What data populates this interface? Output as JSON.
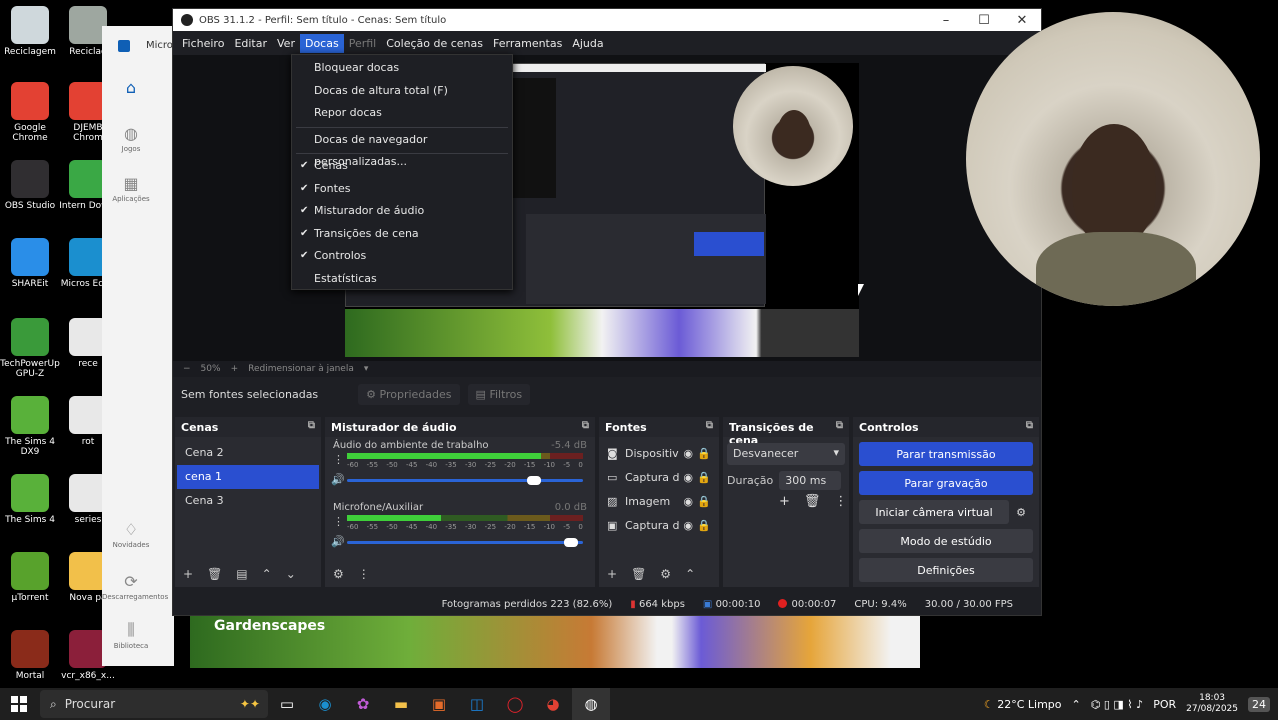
{
  "desktop_icons": [
    {
      "label": "Reciclagem",
      "icon": "recycle-bin-icon",
      "color": "#cfd8dc"
    },
    {
      "label": "Reciclag",
      "icon": "recycle-bin-icon",
      "color": "#9ea7a0"
    },
    {
      "label": "Google Chrome",
      "icon": "chrome-icon",
      "color": "#e34133"
    },
    {
      "label": "DJEMB Chrom",
      "icon": "chrome-icon",
      "color": "#e34133"
    },
    {
      "label": "OBS Studio",
      "icon": "obs-icon",
      "color": "#302e31"
    },
    {
      "label": "Intern Downl",
      "icon": "download-icon",
      "color": "#3aa845"
    },
    {
      "label": "SHAREit",
      "icon": "shareit-icon",
      "color": "#2a8ee8"
    },
    {
      "label": "Micros Edge",
      "icon": "edge-icon",
      "color": "#1b8fcf"
    },
    {
      "label": "TechPowerUp GPU-Z",
      "icon": "gpuz-icon",
      "color": "#3a9a3a"
    },
    {
      "label": "rece",
      "icon": "file-icon",
      "color": "#e8e8e8"
    },
    {
      "label": "The Sims 4 DX9",
      "icon": "sims-icon",
      "color": "#59b13a"
    },
    {
      "label": "rot",
      "icon": "file-icon",
      "color": "#e8e8e8"
    },
    {
      "label": "The Sims 4",
      "icon": "sims-icon",
      "color": "#59b13a"
    },
    {
      "label": "series",
      "icon": "file-icon",
      "color": "#e8e8e8"
    },
    {
      "label": "µTorrent",
      "icon": "utorrent-icon",
      "color": "#58a22c"
    },
    {
      "label": "Nova pa",
      "icon": "folder-icon",
      "color": "#f2c04a"
    },
    {
      "label": "Mortal",
      "icon": "game-icon",
      "color": "#8a2b1a"
    },
    {
      "label": "vcr_x86_x...",
      "icon": "winrar-icon",
      "color": "#8b1f3a"
    }
  ],
  "store_sidebar": {
    "title": "Micro",
    "items": [
      {
        "label": "",
        "icon": "home-icon"
      },
      {
        "label": "Jogos",
        "icon": "gamepad-icon"
      },
      {
        "label": "Aplicações",
        "icon": "apps-icon"
      },
      {
        "label": "Novidades",
        "icon": "bell-icon"
      },
      {
        "label": "Descarregamentos",
        "icon": "download-icon"
      },
      {
        "label": "Biblioteca",
        "icon": "library-icon"
      }
    ]
  },
  "game_banner": {
    "title": "Gardenscapes"
  },
  "obs": {
    "title": "OBS 31.1.2 - Perfil: Sem título - Cenas: Sem título",
    "menu": [
      "Ficheiro",
      "Editar",
      "Ver",
      "Docas",
      "Perfil",
      "Coleção de cenas",
      "Ferramentas",
      "Ajuda"
    ],
    "active_menu": "Docas",
    "zoom": "50%",
    "zoom_mode": "Redimensionar à janela",
    "no_sources": "Sem fontes selecionadas",
    "properties_btn": "Propriedades",
    "filters_btn": "Filtros",
    "docks": {
      "scenes": {
        "title": "Cenas",
        "items": [
          "Cena 2",
          "cena 1",
          "Cena 3"
        ],
        "selected": 1
      },
      "mixer": {
        "title": "Misturador de áudio",
        "channels": [
          {
            "name": "Áudio do ambiente de trabalho",
            "db": "-5.4 dB",
            "level": 0.82,
            "volume": 0.82
          },
          {
            "name": "Microfone/Auxiliar",
            "db": "0.0 dB",
            "level": 0.4,
            "volume": 0.98
          }
        ],
        "ticks": [
          "-60",
          "-55",
          "-50",
          "-45",
          "-40",
          "-35",
          "-30",
          "-25",
          "-20",
          "-15",
          "-10",
          "-5",
          "0"
        ]
      },
      "sources": {
        "title": "Fontes",
        "items": [
          {
            "name": "Dispositiv",
            "icon": "camera-icon"
          },
          {
            "name": "Captura d",
            "icon": "monitor-icon"
          },
          {
            "name": "Imagem",
            "icon": "image-icon"
          },
          {
            "name": "Captura d",
            "icon": "window-icon"
          }
        ]
      },
      "transitions": {
        "title": "Transições de cena",
        "type": "Desvanecer",
        "duration_label": "Duração",
        "duration": "300 ms"
      },
      "controls": {
        "title": "Controlos",
        "buttons": [
          "Parar transmissão",
          "Parar gravação",
          "Iniciar câmera virtual",
          "Modo de estúdio",
          "Definições"
        ]
      }
    },
    "status": {
      "dropped": "Fotogramas perdidos 223 (82.6%)",
      "bitrate": "664 kbps",
      "stream_time": "00:00:10",
      "rec_time": "00:00:07",
      "cpu": "CPU: 9.4%",
      "fps": "30.00 / 30.00 FPS"
    }
  },
  "docas_menu": {
    "group1": [
      "Bloquear docas",
      "Docas de altura total (F)",
      "Repor docas"
    ],
    "group2": [
      "Docas de navegador personalizadas..."
    ],
    "group3": [
      {
        "label": "Cenas",
        "checked": true
      },
      {
        "label": "Fontes",
        "checked": true
      },
      {
        "label": "Misturador de áudio",
        "checked": true
      },
      {
        "label": "Transições de cena",
        "checked": true
      },
      {
        "label": "Controlos",
        "checked": true
      },
      {
        "label": "Estatísticas",
        "checked": false
      }
    ]
  },
  "taskbar": {
    "search_placeholder": "Procurar",
    "weather": "22°C Limpo",
    "lang": "POR",
    "time": "18:03",
    "date": "27/08/2025",
    "notif": "24"
  }
}
